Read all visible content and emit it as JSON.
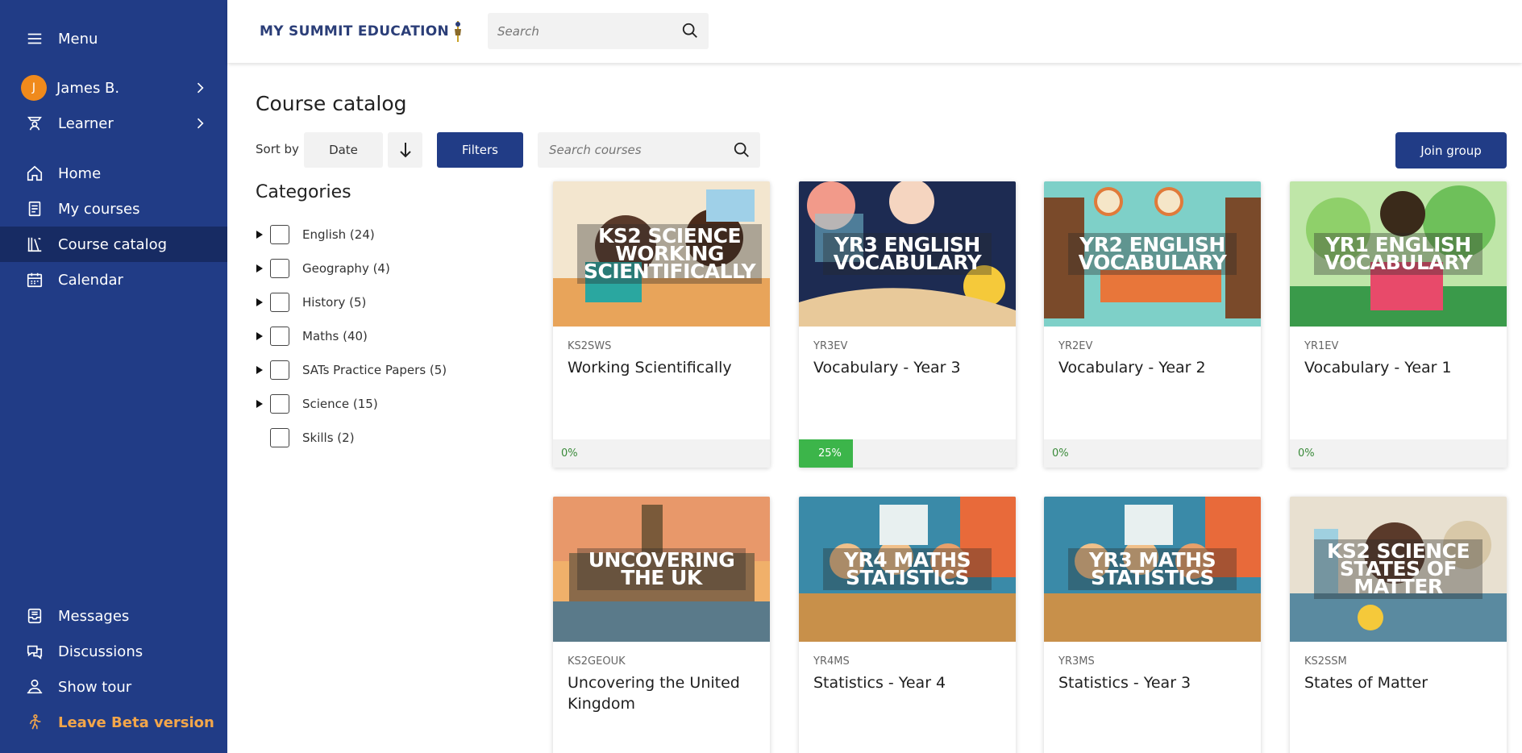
{
  "sidebar": {
    "menu": "Menu",
    "user": {
      "initial": "J",
      "name": "James B."
    },
    "role": "Learner",
    "nav": [
      {
        "label": "Home",
        "icon": "home-icon"
      },
      {
        "label": "My courses",
        "icon": "book-icon"
      },
      {
        "label": "Course catalog",
        "icon": "library-icon",
        "active": true
      },
      {
        "label": "Calendar",
        "icon": "calendar-icon"
      }
    ],
    "bottom": [
      {
        "label": "Messages",
        "icon": "inbox-icon"
      },
      {
        "label": "Discussions",
        "icon": "chat-icon"
      },
      {
        "label": "Show tour",
        "icon": "tour-icon"
      },
      {
        "label": "Leave Beta version",
        "icon": "exit-icon"
      }
    ]
  },
  "header": {
    "logo_text": "MY SUMMIT EDUCATION",
    "search_placeholder": "Search"
  },
  "main": {
    "title": "Course catalog",
    "sort_label": "Sort by",
    "sort_value": "Date",
    "filters_label": "Filters",
    "course_search_placeholder": "Search courses",
    "join_label": "Join group",
    "categories_title": "Categories",
    "categories": [
      {
        "label": "English (24)",
        "expandable": true
      },
      {
        "label": "Geography (4)",
        "expandable": true
      },
      {
        "label": "History (5)",
        "expandable": true
      },
      {
        "label": "Maths (40)",
        "expandable": true
      },
      {
        "label": "SATs Practice Papers (5)",
        "expandable": true
      },
      {
        "label": "Science (15)",
        "expandable": true
      },
      {
        "label": "Skills (2)",
        "expandable": false
      }
    ]
  },
  "courses": [
    {
      "thumb_text": "KS2 Science Working Scientifically",
      "code": "KS2SWS",
      "name": "Working Scientifically",
      "progress": 0,
      "progress_label": "0%",
      "theme": "science"
    },
    {
      "thumb_text": "YR3 English Vocabulary",
      "code": "YR3EV",
      "name": "Vocabulary - Year 3",
      "progress": 25,
      "progress_label": "25%",
      "theme": "space"
    },
    {
      "thumb_text": "YR2 English Vocabulary",
      "code": "YR2EV",
      "name": "Vocabulary - Year 2",
      "progress": 0,
      "progress_label": "0%",
      "theme": "library"
    },
    {
      "thumb_text": "YR1 English Vocabulary",
      "code": "YR1EV",
      "name": "Vocabulary - Year 1",
      "progress": 0,
      "progress_label": "0%",
      "theme": "garden"
    },
    {
      "thumb_text": "Uncovering the UK",
      "code": "KS2GEOUK",
      "name": "Uncovering the United Kingdom",
      "theme": "london"
    },
    {
      "thumb_text": "YR4 Maths Statistics",
      "code": "YR4MS",
      "name": "Statistics - Year 4",
      "theme": "classroom"
    },
    {
      "thumb_text": "YR3 Maths Statistics",
      "code": "YR3MS",
      "name": "Statistics - Year 3",
      "theme": "classroom"
    },
    {
      "thumb_text": "KS2 Science States of Matter",
      "code": "KS2SSM",
      "name": "States of Matter",
      "theme": "lab"
    }
  ]
}
